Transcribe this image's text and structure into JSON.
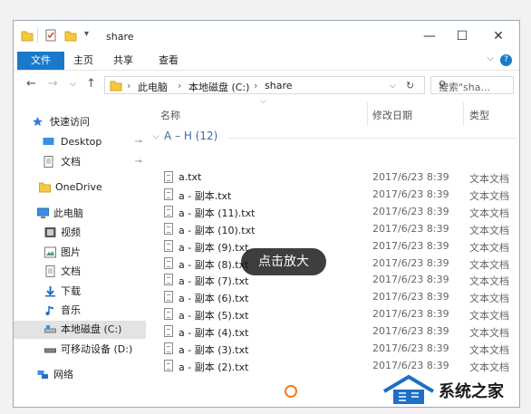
{
  "window": {
    "title": "share",
    "controls": {
      "minimize": "—",
      "maximize": "☐",
      "close": "✕"
    }
  },
  "ribbon": {
    "tabs": [
      "文件",
      "主页",
      "共享",
      "查看"
    ],
    "expand": "⌵",
    "help": "?"
  },
  "nav": {
    "back": "←",
    "forward": "→",
    "dropdown": "⌵",
    "up": "↑",
    "path": [
      "此电脑",
      "本地磁盘 (C:)",
      "share"
    ],
    "separator": "›",
    "refresh": "↻",
    "search_placeholder": "搜索\"sha...",
    "search_icon": "⚲"
  },
  "sidebar": {
    "items": [
      {
        "label": "快速访问",
        "icon": "star-icon",
        "pinned": false
      },
      {
        "label": "Desktop",
        "icon": "desktop-icon",
        "pinned": true
      },
      {
        "label": "文档",
        "icon": "documents-icon",
        "pinned": true
      },
      {
        "label": "OneDrive",
        "icon": "folder-icon",
        "pinned": false
      },
      {
        "label": "此电脑",
        "icon": "computer-icon",
        "pinned": false
      },
      {
        "label": "视频",
        "icon": "videos-icon",
        "pinned": false
      },
      {
        "label": "图片",
        "icon": "pictures-icon",
        "pinned": false
      },
      {
        "label": "文档",
        "icon": "documents-icon",
        "pinned": false
      },
      {
        "label": "下载",
        "icon": "download-icon",
        "pinned": false
      },
      {
        "label": "音乐",
        "icon": "music-icon",
        "pinned": false
      },
      {
        "label": "本地磁盘 (C:)",
        "icon": "drive-icon",
        "selected": true
      },
      {
        "label": "可移动设备 (D:)",
        "icon": "removable-drive-icon",
        "pinned": false
      },
      {
        "label": "网络",
        "icon": "network-icon",
        "pinned": false
      }
    ],
    "pin_glyph": "⊸"
  },
  "columns": {
    "name": "名称",
    "modified": "修改日期",
    "type": "类型"
  },
  "group": {
    "label": "A – H (12)",
    "chevron": "⌵"
  },
  "files": [
    {
      "name": "a.txt",
      "modified": "2017/6/23 8:39",
      "type": "文本文档"
    },
    {
      "name": "a - 副本.txt",
      "modified": "2017/6/23 8:39",
      "type": "文本文档"
    },
    {
      "name": "a - 副本 (11).txt",
      "modified": "2017/6/23 8:39",
      "type": "文本文档"
    },
    {
      "name": "a - 副本 (10).txt",
      "modified": "2017/6/23 8:39",
      "type": "文本文档"
    },
    {
      "name": "a - 副本 (9).txt",
      "modified": "2017/6/23 8:39",
      "type": "文本文档"
    },
    {
      "name": "a - 副本 (8).txt",
      "modified": "2017/6/23 8:39",
      "type": "文本文档"
    },
    {
      "name": "a - 副本 (7).txt",
      "modified": "2017/6/23 8:39",
      "type": "文本文档"
    },
    {
      "name": "a - 副本 (6).txt",
      "modified": "2017/6/23 8:39",
      "type": "文本文档"
    },
    {
      "name": "a - 副本 (5).txt",
      "modified": "2017/6/23 8:39",
      "type": "文本文档"
    },
    {
      "name": "a - 副本 (4).txt",
      "modified": "2017/6/23 8:39",
      "type": "文本文档"
    },
    {
      "name": "a - 副本 (3).txt",
      "modified": "2017/6/23 8:39",
      "type": "文本文档"
    },
    {
      "name": "a - 副本 (2).txt",
      "modified": "2017/6/23 8:39",
      "type": "文本文档"
    }
  ],
  "overlay": {
    "zoom_label": "点击放大"
  },
  "watermark": {
    "text": "系统之家"
  },
  "colors": {
    "accent": "#1979ca",
    "folder": "#f5c842",
    "group_text": "#3b6ea5",
    "spinner": "#f07a20"
  }
}
